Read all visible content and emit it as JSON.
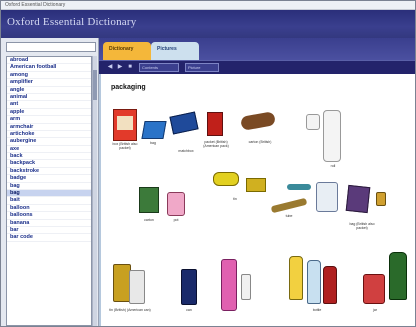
{
  "app": {
    "title_bar": "Oxford Essential Dictionary",
    "name": "Oxford Essential Dictionary"
  },
  "sidebar": {
    "search_value": "",
    "items": [
      "abroad",
      "American football",
      "among",
      "amplifier",
      "angle",
      "animal",
      "ant",
      "apple",
      "arm",
      "armchair",
      "artichoke",
      "aubergine",
      "axe",
      "back",
      "backpack",
      "backstroke",
      "badge",
      "bag",
      "bag",
      "bait",
      "balloon",
      "balloons",
      "banana",
      "bar",
      "bar code"
    ],
    "selected_index": 18
  },
  "tabs": [
    "Dictionary",
    "Pictures"
  ],
  "toolbar": {
    "box1": "Contents",
    "box2": "Picture"
  },
  "content": {
    "heading": "packaging",
    "labels": {
      "box": "box (British also packet)",
      "bag": "bag",
      "matchbox": "matchbox",
      "packet": "packet (British) (American pack)",
      "carton": "carton (British)",
      "roll": "roll",
      "tin": "tin",
      "tube": "tube",
      "bag2": "bag (British also packet)",
      "carton2": "carton",
      "pot": "pot",
      "can": "tin (British) (American can)",
      "jar": "jar",
      "bottle": "bottle",
      "can2": "can"
    }
  }
}
